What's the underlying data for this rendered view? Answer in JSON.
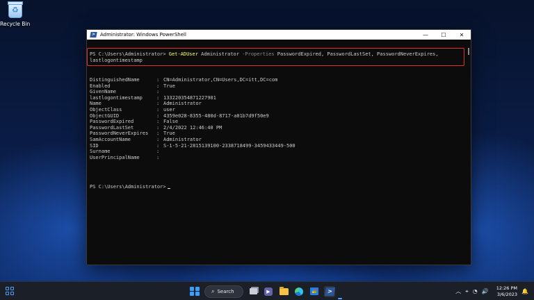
{
  "desktop": {
    "recycle_bin_label": "Recycle Bin"
  },
  "window": {
    "title": "Administrator: Windows PowerShell",
    "minimize_glyph": "—",
    "maximize_glyph": "☐",
    "close_glyph": "✕"
  },
  "console": {
    "prompt": "PS C:\\Users\\Administrator>",
    "command": "Get-ADUser",
    "command_arg": "Administrator",
    "param_flag": "-Properties",
    "param_values": "PasswordExpired, PasswordLastSet, PasswordNeverExpires,",
    "param_values_line2": "lastlogontimestamp",
    "separator": ":",
    "properties": [
      {
        "name": "DistinguishedName",
        "value": "CN=Administrator,CN=Users,DC=itt,DC=com"
      },
      {
        "name": "Enabled",
        "value": "True"
      },
      {
        "name": "GivenName",
        "value": ""
      },
      {
        "name": "lastlogontimestamp",
        "value": "133220354871227901"
      },
      {
        "name": "Name",
        "value": "Administrator"
      },
      {
        "name": "ObjectClass",
        "value": "user"
      },
      {
        "name": "ObjectGUID",
        "value": "4359e028-8355-480d-8717-a01b7d9f50e9"
      },
      {
        "name": "PasswordExpired",
        "value": "False"
      },
      {
        "name": "PasswordLastSet",
        "value": "2/4/2022 12:46:40 PM"
      },
      {
        "name": "PasswordNeverExpires",
        "value": "True"
      },
      {
        "name": "SamAccountName",
        "value": "Administrator"
      },
      {
        "name": "SID",
        "value": "S-1-5-21-2815139100-2338718499-3459433449-500"
      },
      {
        "name": "Surname",
        "value": ""
      },
      {
        "name": "UserPrincipalName",
        "value": ""
      }
    ],
    "prompt2": "PS C:\\Users\\Administrator>"
  },
  "taskbar": {
    "search_label": "Search",
    "search_glyph": "⌕",
    "tray_chevron": "︿",
    "tray_icons": [
      "⌖",
      "◔",
      "🔊"
    ],
    "time": "12:26 PM",
    "date": "3/6/2023",
    "notification_glyph": "🔔"
  },
  "colors": {
    "command_yellow": "#ffff66",
    "param_gray": "#8a8a8a",
    "highlight_red": "#e0302f",
    "console_bg": "#0c0c0c"
  }
}
